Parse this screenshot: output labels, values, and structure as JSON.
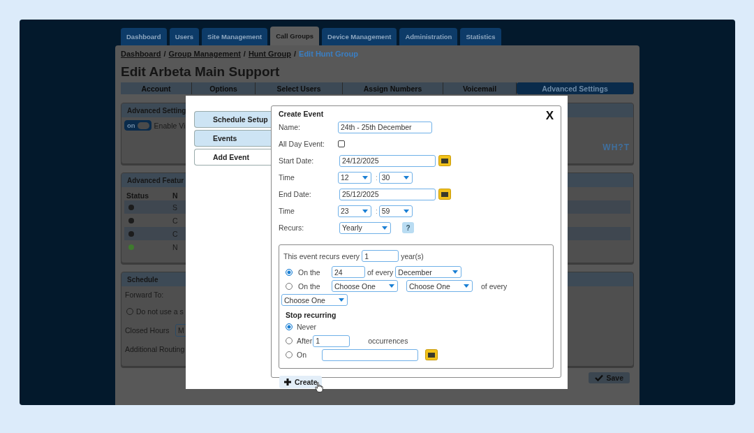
{
  "nav_tabs": [
    {
      "label": "Dashboard",
      "selected": false
    },
    {
      "label": "Users",
      "selected": false
    },
    {
      "label": "Site Management",
      "selected": false
    },
    {
      "label": "Call Groups",
      "selected": true
    },
    {
      "label": "Device Management",
      "selected": false
    },
    {
      "label": "Administration",
      "selected": false
    },
    {
      "label": "Statistics",
      "selected": false
    }
  ],
  "breadcrumb": [
    {
      "label": "Dashboard",
      "current": false
    },
    {
      "label": "Group Management",
      "current": false
    },
    {
      "label": "Hunt Group",
      "current": false
    },
    {
      "label": "Edit Hunt Group",
      "current": true
    }
  ],
  "breadcrumb_separator": "/",
  "page_title": "Edit Arbeta Main Support",
  "section_tabs": [
    {
      "label": "Account",
      "selected": false
    },
    {
      "label": "Options",
      "selected": false
    },
    {
      "label": "Select Users",
      "selected": false
    },
    {
      "label": "Assign Numbers",
      "selected": false
    },
    {
      "label": "Voicemail",
      "selected": false
    },
    {
      "label": "Advanced Settings",
      "selected": true
    }
  ],
  "advanced_settings": {
    "title": "Advanced Setting",
    "toggle": {
      "label": "on",
      "on": true
    },
    "toggle_caption": "Enable Vi",
    "logo": "WH?T"
  },
  "advanced_features": {
    "title": "Advanced Featur",
    "columns": [
      "Status",
      "N"
    ],
    "rows": [
      {
        "color": "#1c1c1c",
        "name": "S"
      },
      {
        "color": "#1c1c1c",
        "name": "C"
      },
      {
        "color": "#1c1c1c",
        "name": "C"
      },
      {
        "color": "#3f7a2e",
        "name": "N"
      }
    ]
  },
  "schedule": {
    "title": "Schedule",
    "forward_to_label": "Forward To:",
    "option": {
      "label": "Do not use a s",
      "selected": false
    },
    "closed_hours_label": "Closed Hours",
    "closed_hours_value": "M",
    "additional_routing_label": "Additional Routing"
  },
  "save_button": "Save",
  "dialog": {
    "side_tabs": [
      {
        "label": "Schedule Setup",
        "selected": false
      },
      {
        "label": "Events",
        "selected": false
      },
      {
        "label": "Add Event",
        "selected": true
      }
    ],
    "title": "Create Event",
    "close": "X",
    "name": {
      "label": "Name:",
      "value": "24th - 25th December"
    },
    "all_day": {
      "label": "All Day Event:",
      "checked": false
    },
    "start_date": {
      "label": "Start Date:",
      "value": "24/12/2025"
    },
    "start_time": {
      "label": "Time",
      "hour": "12",
      "separator": ":",
      "minute": "30"
    },
    "end_date": {
      "label": "End Date:",
      "value": "25/12/2025"
    },
    "end_time": {
      "label": "Time",
      "hour": "23",
      "separator": ":",
      "minute": "59"
    },
    "recurs": {
      "label": "Recurs:",
      "value": "Yearly",
      "help": "?"
    },
    "recurrence": {
      "intro": "This event recurs every",
      "interval": "1",
      "unit": "year(s)",
      "options": [
        {
          "kind": "date",
          "selected": true,
          "label": "On the",
          "day": "24",
          "joiner": "of every",
          "month": "December"
        },
        {
          "kind": "weekday",
          "selected": false,
          "label": "On the",
          "ordinal": "Choose One",
          "weekday": "Choose One",
          "joiner": "of every",
          "month": "Choose One"
        }
      ],
      "stop_title": "Stop recurring",
      "stop_options": [
        {
          "kind": "never",
          "selected": true,
          "label": "Never"
        },
        {
          "kind": "after",
          "selected": false,
          "label": "After",
          "value": "1",
          "suffix": "occurrences"
        },
        {
          "kind": "on",
          "selected": false,
          "label": "On"
        }
      ]
    },
    "create_button": "Create"
  }
}
